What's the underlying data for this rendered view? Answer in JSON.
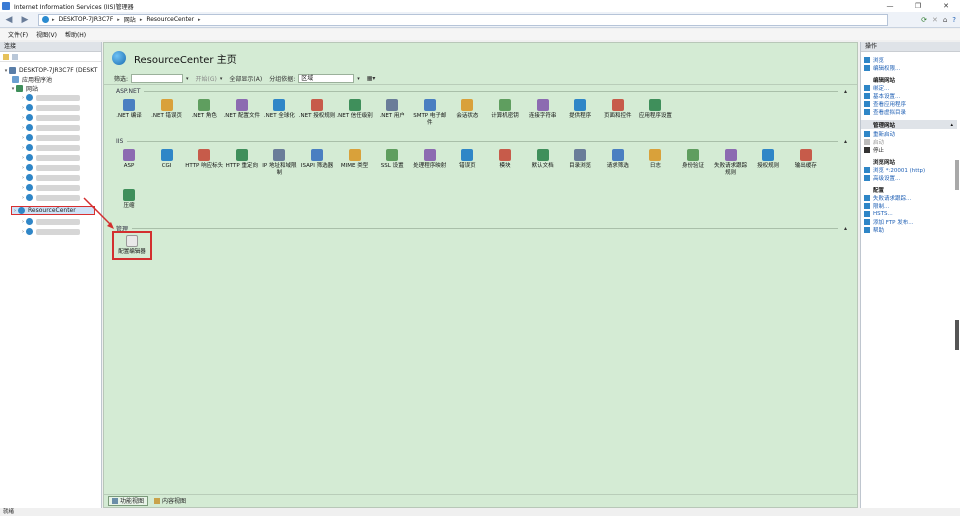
{
  "window": {
    "title": "Internet Information Services (IIS)管理器",
    "controls": [
      "—",
      "❐",
      "✕"
    ]
  },
  "address": {
    "crumbs": [
      "DESKTOP-7JR3C7F",
      "网站",
      "ResourceCenter"
    ]
  },
  "menu": [
    "文件(F)",
    "视图(V)",
    "帮助(H)"
  ],
  "left": {
    "header": "连接",
    "server": "DESKTOP-7JR3C7F (DESKT",
    "app_pools": "应用程序池",
    "sites": "网站",
    "selected_site": "ResourceCenter"
  },
  "center": {
    "title": "ResourceCenter 主页",
    "filter": {
      "label": "筛选:",
      "start": "开始(G)",
      "show_all": "全部显示(A)",
      "group_label": "分组依据:",
      "group_value": "区域"
    },
    "sections": {
      "aspnet": "ASP.NET",
      "iis": "IIS",
      "manage": "管理"
    },
    "aspnet_tiles": [
      ".NET 编译",
      ".NET 错误页",
      ".NET 角色",
      ".NET 配置文件",
      ".NET 全球化",
      ".NET 授权规则",
      ".NET 信任级别",
      ".NET 用户",
      "SMTP 电子邮件",
      "会话状态",
      "计算机密钥",
      "连接字符串",
      "提供程序",
      "页面和控件",
      "应用程序设置"
    ],
    "iis_tiles": [
      "ASP",
      "CGI",
      "HTTP 响应标头",
      "HTTP 重定向",
      "IP 地址和域限制",
      "ISAPI 筛选器",
      "MIME 类型",
      "SSL 设置",
      "处理程序映射",
      "错误页",
      "模块",
      "默认文档",
      "目录浏览",
      "请求筛选",
      "日志",
      "身份验证",
      "失败请求跟踪规则",
      "授权规则",
      "输出缓存",
      "压缩"
    ],
    "manage_tiles": [
      "配置编辑器"
    ],
    "view_tabs": [
      "功能视图",
      "内容视图"
    ]
  },
  "right": {
    "header": "操作",
    "items": [
      {
        "kind": "link",
        "text": "浏览"
      },
      {
        "kind": "link",
        "text": "编辑权限..."
      },
      {
        "kind": "group",
        "text": "编辑网站"
      },
      {
        "kind": "link",
        "text": "绑定..."
      },
      {
        "kind": "link",
        "text": "基本设置..."
      },
      {
        "kind": "link",
        "text": "查看应用程序"
      },
      {
        "kind": "link",
        "text": "查看虚拟目录"
      },
      {
        "kind": "ghead",
        "text": "管理网站"
      },
      {
        "kind": "link",
        "text": "重新启动"
      },
      {
        "kind": "grey",
        "text": "启动"
      },
      {
        "kind": "plain",
        "text": "停止"
      },
      {
        "kind": "group",
        "text": "浏览网站"
      },
      {
        "kind": "link",
        "text": "浏览 *:20001 (http)"
      },
      {
        "kind": "link",
        "text": "高级设置..."
      },
      {
        "kind": "group",
        "text": "配置"
      },
      {
        "kind": "link",
        "text": "失败请求跟踪..."
      },
      {
        "kind": "link",
        "text": "限制..."
      },
      {
        "kind": "link",
        "text": "HSTS..."
      },
      {
        "kind": "link",
        "text": "添加 FTP 发布..."
      },
      {
        "kind": "link",
        "text": "帮助"
      }
    ]
  },
  "status": "就绪",
  "colors": {
    "center_bg": "#d4ebd4",
    "highlight": "#d32f2f",
    "link": "#1e5fb4"
  }
}
